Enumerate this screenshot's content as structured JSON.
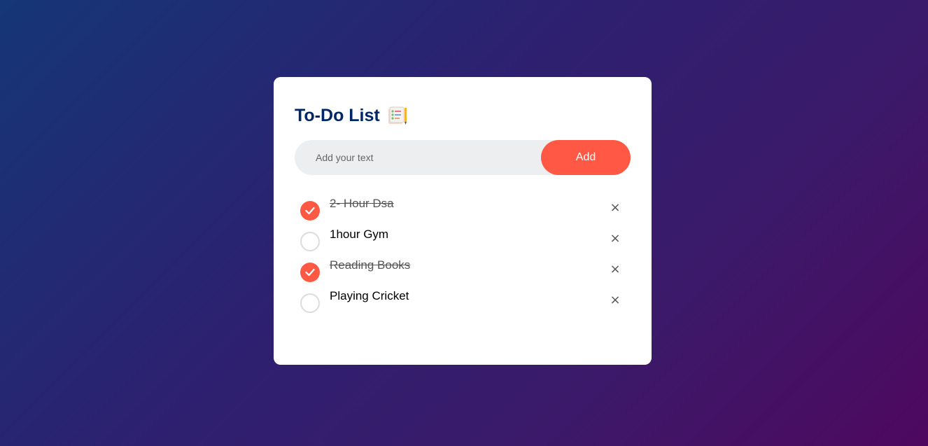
{
  "app": {
    "title": "To-Do List",
    "title_icon": "notepad-checklist-icon"
  },
  "input": {
    "placeholder": "Add your text",
    "value": ""
  },
  "add_button": {
    "label": "Add"
  },
  "tasks": [
    {
      "text": "2- Hour Dsa",
      "checked": true,
      "remove_label": "×"
    },
    {
      "text": "1hour Gym",
      "checked": false,
      "remove_label": "×"
    },
    {
      "text": "Reading Books",
      "checked": true,
      "remove_label": "×"
    },
    {
      "text": "Playing Cricket",
      "checked": false,
      "remove_label": "×"
    }
  ],
  "colors": {
    "accent": "#ff5945",
    "title": "#002765",
    "input_bg": "#edeef0",
    "card_bg": "#ffffff"
  }
}
